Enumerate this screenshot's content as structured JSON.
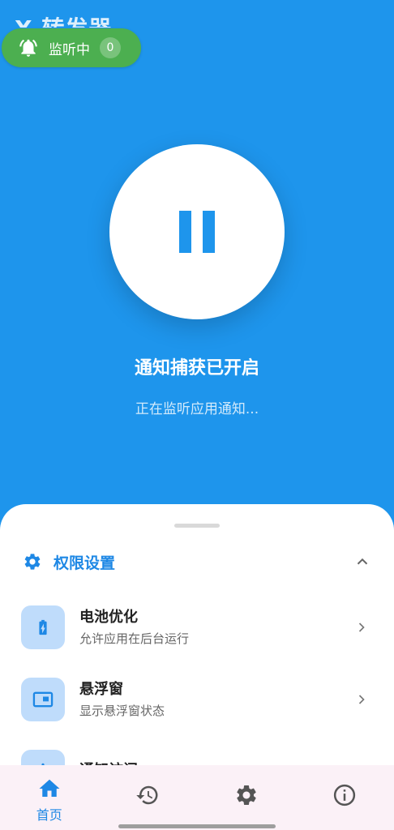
{
  "app": {
    "title": "X 转发器"
  },
  "listen_pill": {
    "label": "监听中",
    "count": "0",
    "color": "#4caf50"
  },
  "main": {
    "toggle_icon": "pause-icon",
    "status_title": "通知捕获已开启",
    "status_sub": "正在监听应用通知..."
  },
  "colors": {
    "accent": "#1e95ec",
    "icon_bg": "#bfdcfb"
  },
  "permissions": {
    "header": "权限设置",
    "items": [
      {
        "title": "电池优化",
        "subtitle": "允许应用在后台运行",
        "icon": "battery-icon"
      },
      {
        "title": "悬浮窗",
        "subtitle": "显示悬浮窗状态",
        "icon": "floating-window-icon"
      },
      {
        "title": "通知访问",
        "subtitle": "",
        "icon": "notification-access-icon"
      }
    ]
  },
  "nav": [
    {
      "label": "首页",
      "icon": "home-icon",
      "active": true
    },
    {
      "label": "",
      "icon": "history-icon"
    },
    {
      "label": "",
      "icon": "settings-icon"
    },
    {
      "label": "",
      "icon": "info-icon"
    }
  ]
}
